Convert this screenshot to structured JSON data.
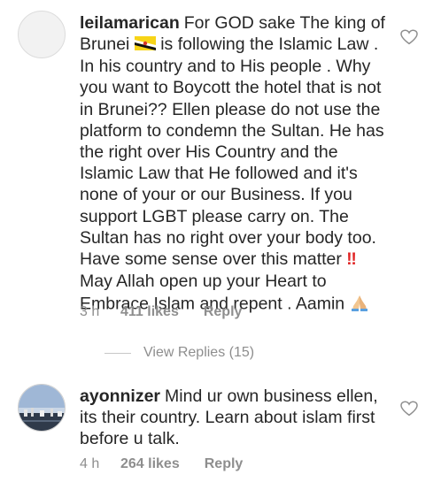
{
  "comments": [
    {
      "username": "leilamarican",
      "text_parts": [
        "For GOD sake The king of Brunei ",
        " is following the Islamic Law . In his country and to His people . Why you want to Boycott the hotel that is not in Brunei?? Ellen please do not use the platform to condemn the Sultan. He has the right over His Country and the Islamic Law that He followed and it's none of your or our Business. If you support LGBT please carry on. The Sultan has no right over your body too. Have some sense over this  matter ",
        " May Allah open up your Heart to Embrace Islam and repent . Aamin "
      ],
      "emojis": [
        "brunei-flag-emoji",
        "double-exclamation-emoji",
        "praying-hands-emoji"
      ],
      "time": "3 h",
      "likes": "411 likes",
      "reply_label": "Reply",
      "icon": "heart-outline-icon"
    },
    {
      "username": "ayonnizer",
      "text_parts": [
        "Mind ur own business ellen, its their country. Learn about islam first before u talk."
      ],
      "time": "4 h",
      "likes": "264 likes",
      "reply_label": "Reply",
      "icon": "heart-outline-icon"
    }
  ],
  "view_replies_label": "View Replies (15)",
  "colors": {
    "text": "#262626",
    "meta": "#8e8e8e",
    "double_exclamation": "#e02424",
    "flag_yellow": "#f7d417",
    "flag_black": "#111111",
    "flag_white": "#ffffff"
  }
}
